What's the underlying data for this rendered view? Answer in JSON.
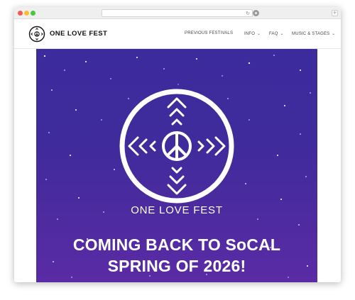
{
  "browser": {
    "window_controls": [
      "close",
      "minimize",
      "maximize"
    ],
    "reload_icon": "reload-icon",
    "extension_icon": "extension-icon",
    "new_tab_symbol": "+"
  },
  "header": {
    "brand": "ONE LOVE FEST",
    "logo_icon": "peace-emblem-logo",
    "nav": [
      {
        "label": "PREVIOUS FESTIVALS",
        "has_dropdown": false
      },
      {
        "label": "INFO",
        "has_dropdown": true
      },
      {
        "label": "FAQ",
        "has_dropdown": true
      },
      {
        "label": "MUSIC & STAGES",
        "has_dropdown": true
      }
    ],
    "dropdown_icon": "chevron-down-icon"
  },
  "hero": {
    "brand": "ONE LOVE FEST",
    "line1": "COMING BACK TO SoCAL",
    "line2": "SPRING OF 2026!",
    "colors": {
      "top": "#3c2b9d",
      "bottom": "#5a2ba5",
      "text": "#ffffff"
    }
  }
}
